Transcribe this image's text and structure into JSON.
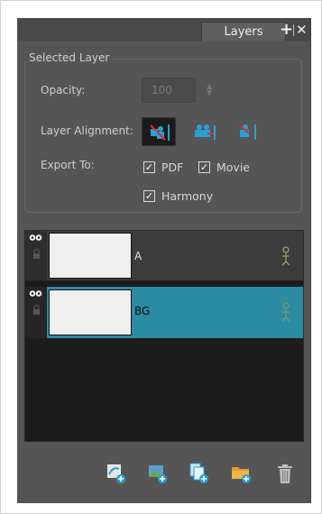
{
  "panel": {
    "tab_label": "Layers",
    "tab_add_icon": "plus-icon",
    "tab_close_icon": "close-icon"
  },
  "selected_layer": {
    "title": "Selected Layer",
    "opacity_label": "Opacity:",
    "opacity_value": "100",
    "alignment_label": "Layer Alignment:",
    "alignment_options": [
      "align-left-icon",
      "align-center-icon",
      "align-right-icon"
    ],
    "alignment_selected_index": 0,
    "export_label": "Export To:",
    "export_options": [
      {
        "label": "PDF",
        "checked": true
      },
      {
        "label": "Movie",
        "checked": true
      },
      {
        "label": "Harmony",
        "checked": true
      }
    ]
  },
  "layers": [
    {
      "name": "A",
      "selected": false
    },
    {
      "name": "BG",
      "selected": true
    }
  ],
  "toolbar": {
    "buttons": [
      "add-vector-layer-icon",
      "add-bitmap-layer-icon",
      "duplicate-layer-icon",
      "add-group-icon",
      "delete-layer-icon"
    ]
  },
  "colors": {
    "panel_bg": "#555555",
    "selected_row": "#2a8ba3",
    "list_bg": "#1c1c1c",
    "accent_blue": "#2a9fd6",
    "accent_red": "#d32f2f"
  }
}
